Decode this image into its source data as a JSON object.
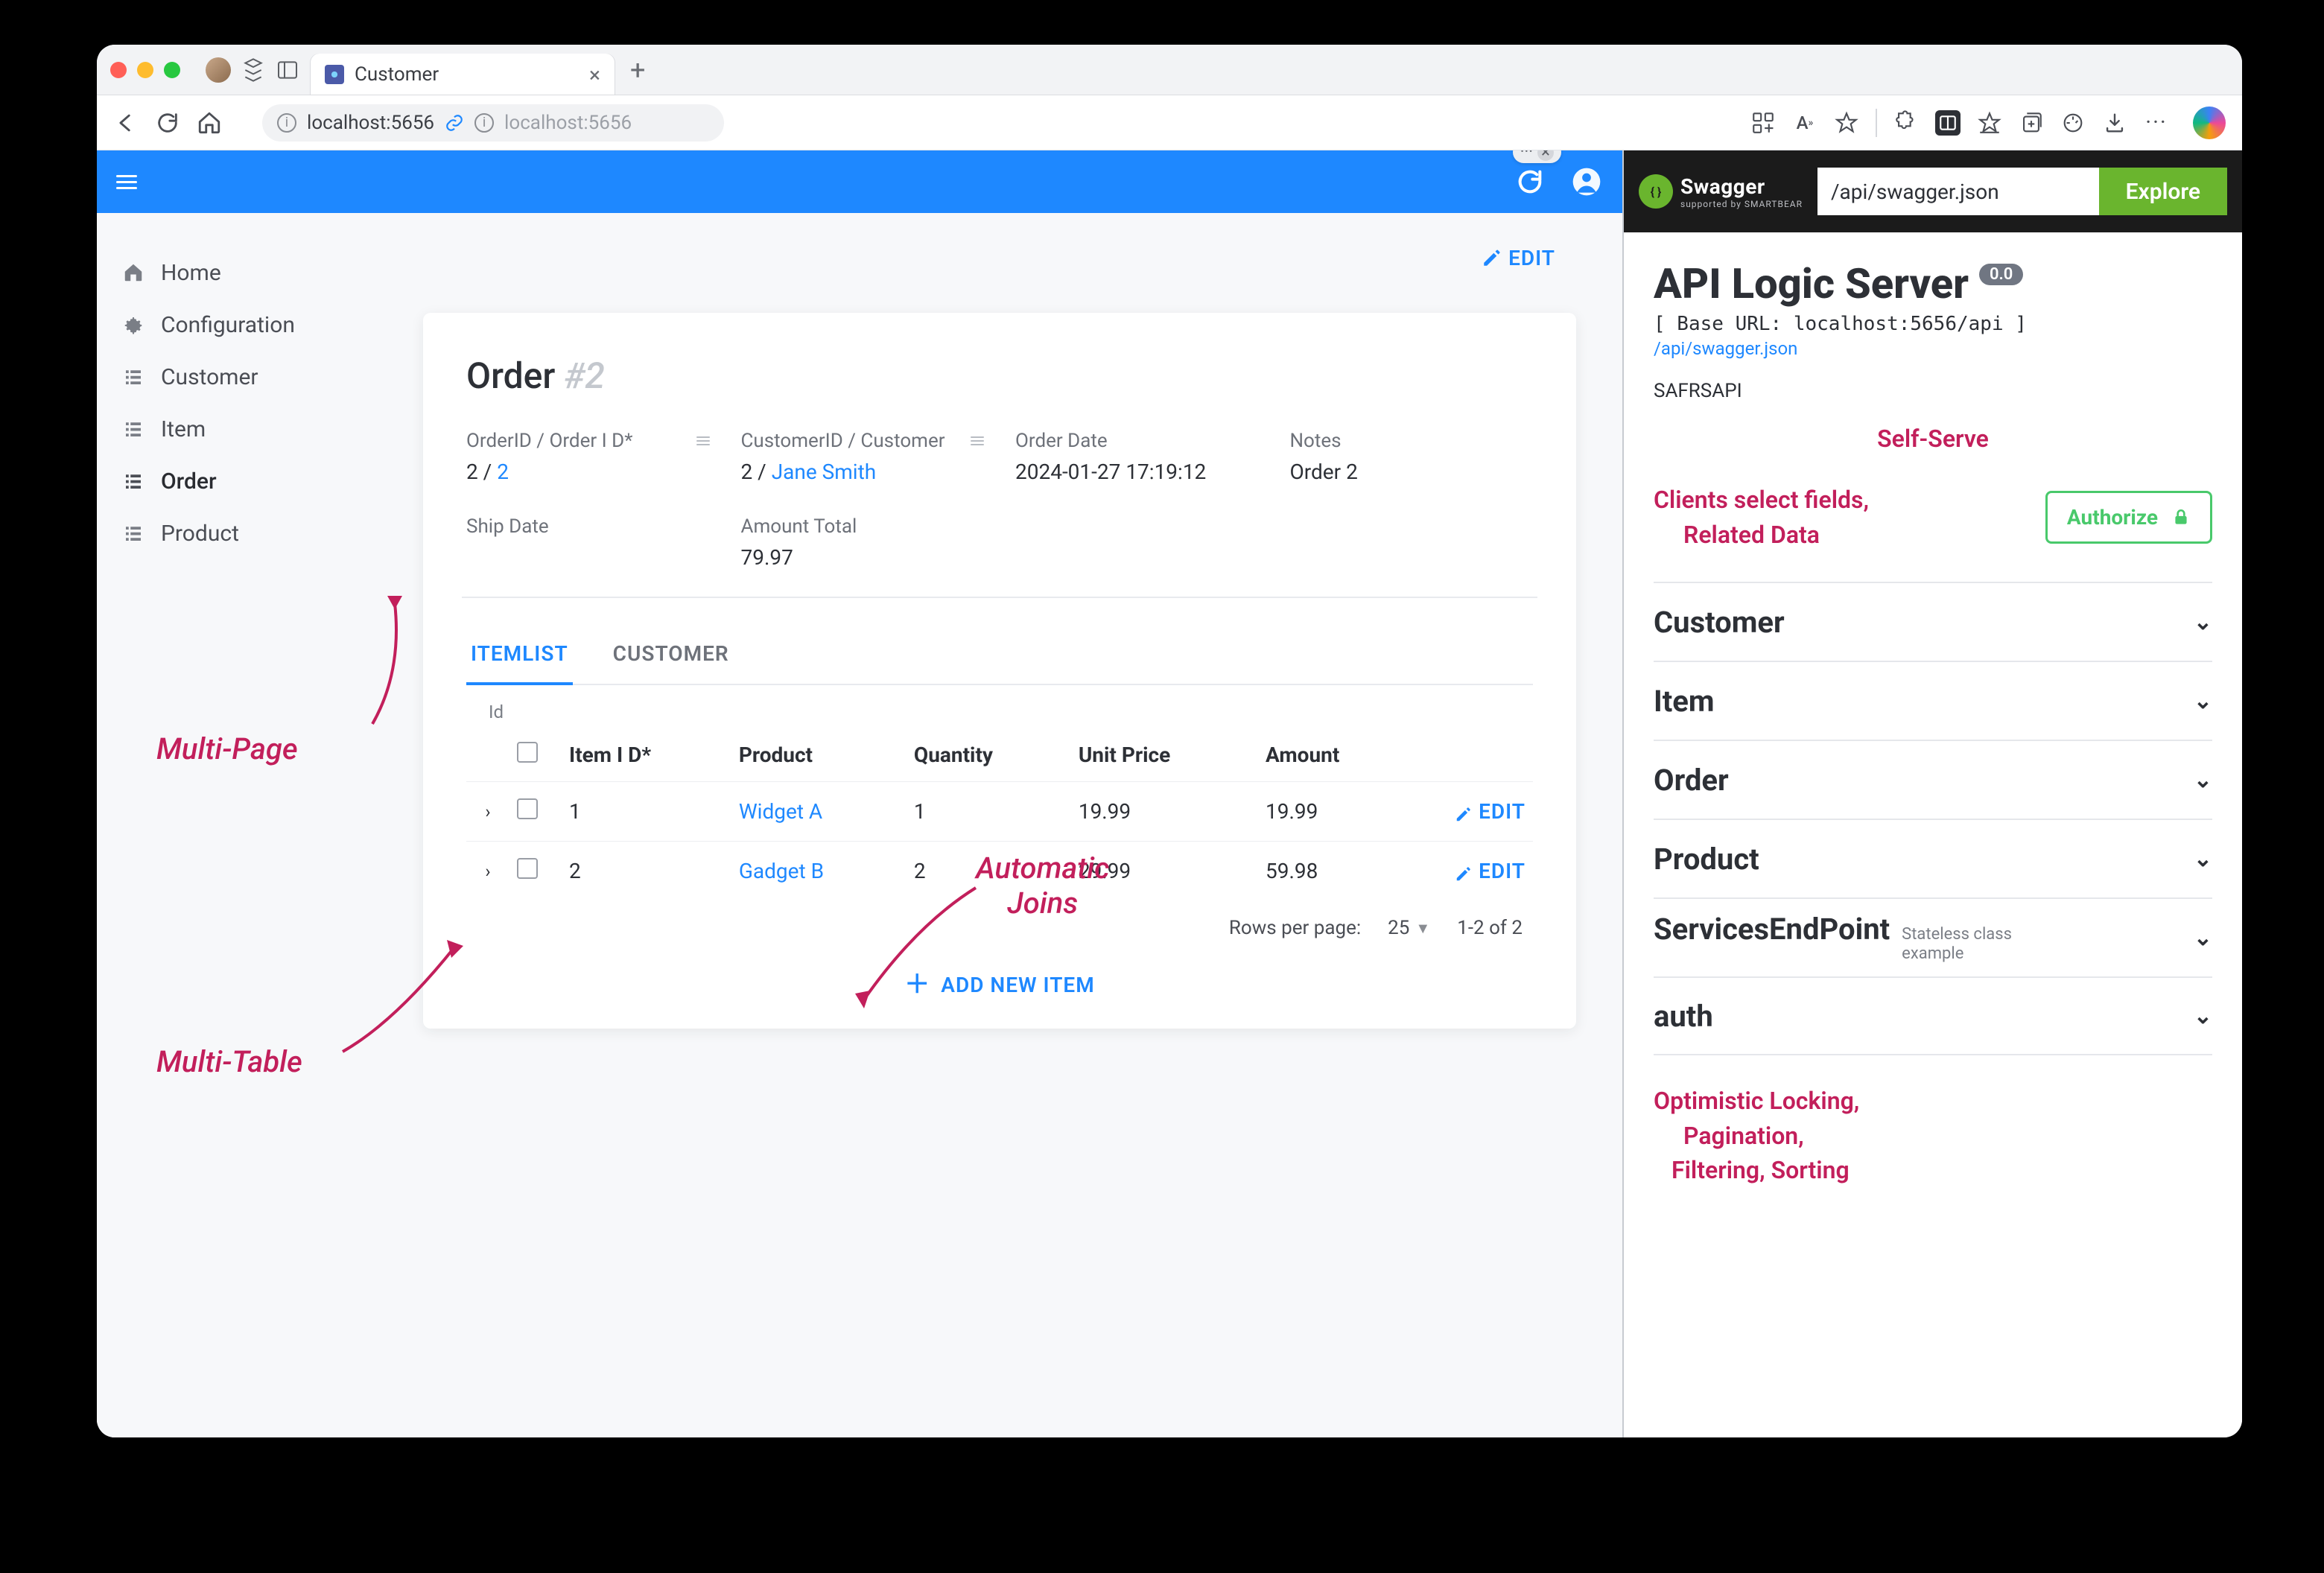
{
  "browser": {
    "tab_title": "Customer",
    "address": {
      "host": "localhost:5656",
      "secondary": "localhost:5656"
    }
  },
  "sidebar": {
    "items": [
      {
        "label": "Home",
        "icon": "home-icon"
      },
      {
        "label": "Configuration",
        "icon": "gear-icon"
      },
      {
        "label": "Customer",
        "icon": "list-icon"
      },
      {
        "label": "Item",
        "icon": "list-icon"
      },
      {
        "label": "Order",
        "icon": "list-icon",
        "active": true
      },
      {
        "label": "Product",
        "icon": "list-icon"
      }
    ]
  },
  "annotations": {
    "multipage": "Multi-Page",
    "multitable": "Multi-Table",
    "autojoins_line1": "Automatic",
    "autojoins_line2": "Joins",
    "selfserve": "Self-Serve",
    "clients_line1": "Clients select fields,",
    "clients_line2": "Related Data",
    "footer_line1": "Optimistic Locking,",
    "footer_line2": "Pagination,",
    "footer_line3": "Filtering, Sorting"
  },
  "order": {
    "edit_btn": "EDIT",
    "title": "Order",
    "title_suffix": "#2",
    "fields": {
      "orderid_label": "OrderID / Order I D*",
      "orderid_value_plain": "2 /",
      "orderid_value_link": "2",
      "customerid_label": "CustomerID / Customer",
      "customerid_value_plain": "2 /",
      "customerid_value_link": "Jane Smith",
      "orderdate_label": "Order Date",
      "orderdate_value": "2024-01-27 17:19:12",
      "notes_label": "Notes",
      "notes_value": "Order 2",
      "shipdate_label": "Ship Date",
      "shipdate_value": "",
      "amounttotal_label": "Amount Total",
      "amounttotal_value": "79.97"
    },
    "tabs": {
      "itemlist": "ITEMLIST",
      "customer": "CUSTOMER"
    },
    "subhead": "Id",
    "columns": {
      "itemid": "Item I D*",
      "product": "Product",
      "qty": "Quantity",
      "unitprice": "Unit Price",
      "amount": "Amount"
    },
    "rows": [
      {
        "id": "1",
        "product": "Widget A",
        "qty": "1",
        "unitprice": "19.99",
        "amount": "19.99"
      },
      {
        "id": "2",
        "product": "Gadget B",
        "qty": "2",
        "unitprice": "29.99",
        "amount": "59.98"
      }
    ],
    "row_edit": "EDIT",
    "pager": {
      "label": "Rows per page:",
      "size": "25",
      "range": "1-2 of 2"
    },
    "addnew": "ADD NEW ITEM"
  },
  "swagger": {
    "logo_text": "Swagger",
    "logo_sub": "supported by SMARTBEAR",
    "input_value": "/api/swagger.json",
    "explore": "Explore",
    "title": "API Logic Server",
    "version": "0.0",
    "base_url": "[ Base URL: localhost:5656/api ]",
    "json_link": "/api/swagger.json",
    "api_name": "SAFRSAPI",
    "authorize": "Authorize",
    "sections": [
      {
        "name": "Customer"
      },
      {
        "name": "Item"
      },
      {
        "name": "Order"
      },
      {
        "name": "Product"
      },
      {
        "name": "ServicesEndPoint",
        "desc": "Stateless class example"
      },
      {
        "name": "auth"
      }
    ]
  }
}
